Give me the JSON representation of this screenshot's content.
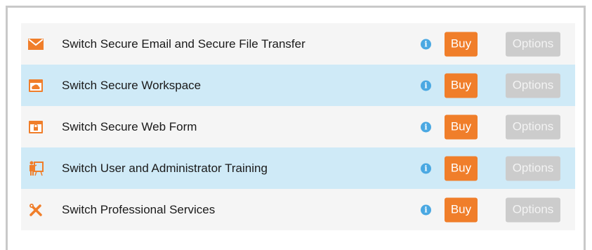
{
  "colors": {
    "accent_orange": "#f07e2a",
    "info_blue": "#4aa8e2",
    "row_alt_blue": "#cfeaf7",
    "row_grey": "#f5f5f5",
    "options_disabled": "#cccccc"
  },
  "products": [
    {
      "name": "Switch Secure Email and Secure File Transfer",
      "icon": "envelope-icon",
      "info_glyph": "i",
      "buy_label": "Buy",
      "options_label": "Options"
    },
    {
      "name": "Switch Secure Workspace",
      "icon": "cloud-window-icon",
      "info_glyph": "i",
      "buy_label": "Buy",
      "options_label": "Options"
    },
    {
      "name": "Switch Secure Web Form",
      "icon": "lock-window-icon",
      "info_glyph": "i",
      "buy_label": "Buy",
      "options_label": "Options"
    },
    {
      "name": "Switch User and Administrator Training",
      "icon": "presentation-icon",
      "info_glyph": "i",
      "buy_label": "Buy",
      "options_label": "Options"
    },
    {
      "name": "Switch Professional Services",
      "icon": "tools-icon",
      "info_glyph": "i",
      "buy_label": "Buy",
      "options_label": "Options"
    }
  ]
}
